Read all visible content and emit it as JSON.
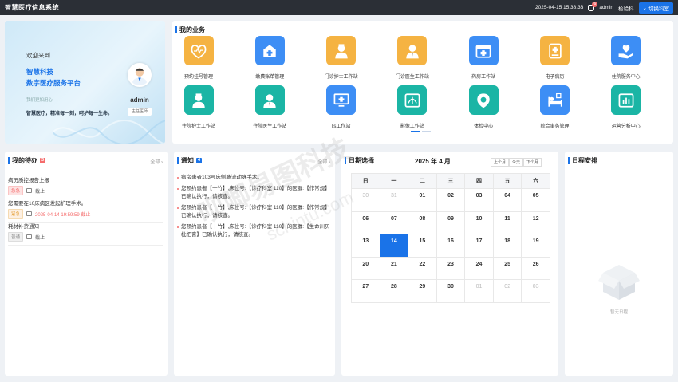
{
  "header": {
    "title": "智慧医疗信息系统",
    "datetime": "2025-04-15 15:38:33",
    "notification_count": "6",
    "user": "admin",
    "department": "检验科",
    "switch_label": "切换科室"
  },
  "welcome": {
    "greeting": "欢迎来到",
    "line1": "智慧科技",
    "line2": "数字医疗服务平台",
    "sub": "我们更加用心",
    "slogan": "智慧医疗，精准每一刻，呵护每一生命。",
    "username": "admin",
    "role": "主任医师"
  },
  "business": {
    "title": "我的业务",
    "tiles": [
      {
        "label": "预约挂号管理",
        "icon": "heartbeat-icon",
        "color": "#f5b342"
      },
      {
        "label": "缴费账单管理",
        "icon": "hospital-icon",
        "color": "#3d8ef5"
      },
      {
        "label": "门诊护士工作站",
        "icon": "nurse-icon",
        "color": "#f5b342"
      },
      {
        "label": "门诊医生工作站",
        "icon": "doctor-icon",
        "color": "#f5b342"
      },
      {
        "label": "药房工作站",
        "icon": "pharmacy-icon",
        "color": "#3d8ef5"
      },
      {
        "label": "电子病历",
        "icon": "medical-record-icon",
        "color": "#f5b342"
      },
      {
        "label": "住院服务中心",
        "icon": "care-hand-icon",
        "color": "#3d8ef5"
      },
      {
        "label": "住院护士工作站",
        "icon": "nurse-icon",
        "color": "#1bb5a5"
      },
      {
        "label": "住院医生工作站",
        "icon": "doctor-icon",
        "color": "#1bb5a5"
      },
      {
        "label": "lis工作站",
        "icon": "monitor-icon",
        "color": "#3d8ef5"
      },
      {
        "label": "影像工作站",
        "icon": "imaging-icon",
        "color": "#1bb5a5"
      },
      {
        "label": "体检中心",
        "icon": "location-pin-icon",
        "color": "#1bb5a5"
      },
      {
        "label": "综合事务管理",
        "icon": "bed-icon",
        "color": "#3d8ef5"
      },
      {
        "label": "运营分析中心",
        "icon": "analytics-icon",
        "color": "#1bb5a5"
      }
    ]
  },
  "todo": {
    "title": "我的待办",
    "count": "3",
    "more": "全部",
    "items": [
      {
        "title": "病历质控报告上报",
        "tag": "急急",
        "tag_style": "red",
        "time": "截止"
      },
      {
        "title": "您需要在10床病区发起护理手术。",
        "tag": "紧急",
        "tag_style": "orange",
        "time": "2025-04-14 19:59:59 截止"
      },
      {
        "title": "耗材补货通知",
        "tag": "普通",
        "tag_style": "gray",
        "time": "截止"
      }
    ]
  },
  "notice": {
    "title": "通知",
    "count": "4",
    "more": "全部",
    "items": [
      "病房患者103号床侧脉流动脉手术。",
      "您预约患者【十竹】,床位号:【诊疗科室 110】的医嘱:【作常规】已确认执行，请核查。",
      "您预约患者【十竹】,床位号:【诊疗科室 110】的医嘱:【作常规】已确认执行，请核查。",
      "您预约患者【十竹】,床位号:【诊疗科室 110】的医嘱:【生命川贝枇杷膏】已确认执行，请核查。"
    ]
  },
  "calendar": {
    "title": "日期选择",
    "month_label": "2025 年 4 月",
    "buttons": [
      "上个月",
      "今天",
      "下个月"
    ],
    "weekdays": [
      "日",
      "一",
      "二",
      "三",
      "四",
      "五",
      "六"
    ],
    "weeks": [
      [
        {
          "d": "30",
          "dim": true
        },
        {
          "d": "31",
          "dim": true
        },
        {
          "d": "01"
        },
        {
          "d": "02"
        },
        {
          "d": "03"
        },
        {
          "d": "04"
        },
        {
          "d": "05"
        }
      ],
      [
        {
          "d": "06"
        },
        {
          "d": "07"
        },
        {
          "d": "08"
        },
        {
          "d": "09"
        },
        {
          "d": "10"
        },
        {
          "d": "11"
        },
        {
          "d": "12"
        }
      ],
      [
        {
          "d": "13"
        },
        {
          "d": "14",
          "today": true
        },
        {
          "d": "15"
        },
        {
          "d": "16"
        },
        {
          "d": "17"
        },
        {
          "d": "18"
        },
        {
          "d": "19"
        }
      ],
      [
        {
          "d": "20"
        },
        {
          "d": "21"
        },
        {
          "d": "22"
        },
        {
          "d": "23"
        },
        {
          "d": "24"
        },
        {
          "d": "25"
        },
        {
          "d": "26"
        }
      ],
      [
        {
          "d": "27"
        },
        {
          "d": "28"
        },
        {
          "d": "29"
        },
        {
          "d": "30"
        },
        {
          "d": "01",
          "dim": true
        },
        {
          "d": "02",
          "dim": true
        },
        {
          "d": "03",
          "dim": true
        }
      ]
    ]
  },
  "schedule": {
    "title": "日程安排",
    "empty_text": "暂无日程"
  },
  "watermark": {
    "line1": "呗唧易图科技",
    "line2": "schintu.com"
  }
}
